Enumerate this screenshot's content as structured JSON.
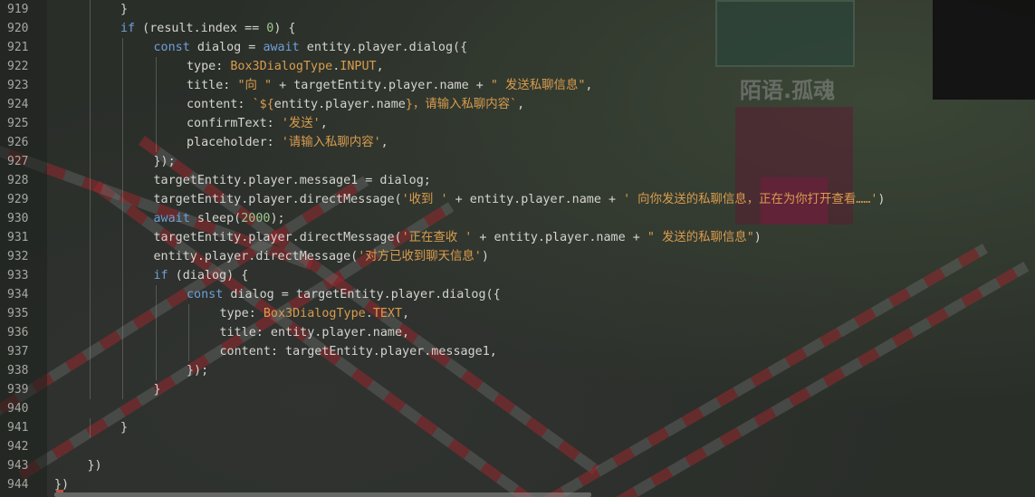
{
  "watermark": "陌语.孤魂",
  "lines": [
    {
      "no": "919",
      "indent": 2,
      "tokens": [
        {
          "t": "}",
          "c": ""
        }
      ]
    },
    {
      "no": "920",
      "indent": 2,
      "tokens": [
        {
          "t": "if",
          "c": "kw"
        },
        {
          "t": " (result.index == ",
          "c": ""
        },
        {
          "t": "0",
          "c": "num"
        },
        {
          "t": ") {",
          "c": ""
        }
      ]
    },
    {
      "no": "921",
      "indent": 3,
      "tokens": [
        {
          "t": "const",
          "c": "kw"
        },
        {
          "t": " dialog = ",
          "c": ""
        },
        {
          "t": "await",
          "c": "kw"
        },
        {
          "t": " entity.player.dialog({",
          "c": ""
        }
      ]
    },
    {
      "no": "922",
      "indent": 4,
      "tokens": [
        {
          "t": "type: ",
          "c": ""
        },
        {
          "t": "Box3DialogType",
          "c": "cls"
        },
        {
          "t": ".",
          "c": ""
        },
        {
          "t": "INPUT",
          "c": "cls"
        },
        {
          "t": ",",
          "c": ""
        }
      ]
    },
    {
      "no": "923",
      "indent": 4,
      "tokens": [
        {
          "t": "title: ",
          "c": ""
        },
        {
          "t": "\"向 \"",
          "c": "str"
        },
        {
          "t": " + targetEntity.player.name + ",
          "c": ""
        },
        {
          "t": "\" 发送私聊信息\"",
          "c": "str"
        },
        {
          "t": ",",
          "c": ""
        }
      ]
    },
    {
      "no": "924",
      "indent": 4,
      "tokens": [
        {
          "t": "content: ",
          "c": ""
        },
        {
          "t": "`${",
          "c": "str"
        },
        {
          "t": "entity.player.name",
          "c": ""
        },
        {
          "t": "}，请输入私聊内容`",
          "c": "str"
        },
        {
          "t": ",",
          "c": ""
        }
      ]
    },
    {
      "no": "925",
      "indent": 4,
      "tokens": [
        {
          "t": "confirmText: ",
          "c": ""
        },
        {
          "t": "'发送'",
          "c": "str"
        },
        {
          "t": ",",
          "c": ""
        }
      ]
    },
    {
      "no": "926",
      "indent": 4,
      "tokens": [
        {
          "t": "placeholder: ",
          "c": ""
        },
        {
          "t": "'请输入私聊内容'",
          "c": "str"
        },
        {
          "t": ",",
          "c": ""
        }
      ]
    },
    {
      "no": "927",
      "indent": 3,
      "tokens": [
        {
          "t": "});",
          "c": ""
        }
      ]
    },
    {
      "no": "928",
      "indent": 3,
      "tokens": [
        {
          "t": "targetEntity.player.message1 = dialog;",
          "c": ""
        }
      ]
    },
    {
      "no": "929",
      "indent": 3,
      "tokens": [
        {
          "t": "targetEntity.player.directMessage(",
          "c": ""
        },
        {
          "t": "'收到 '",
          "c": "str"
        },
        {
          "t": " + entity.player.name + ",
          "c": ""
        },
        {
          "t": "' 向你发送的私聊信息，正在为你打开查看……'",
          "c": "str"
        },
        {
          "t": ")",
          "c": ""
        }
      ]
    },
    {
      "no": "930",
      "indent": 3,
      "tokens": [
        {
          "t": "await",
          "c": "kw"
        },
        {
          "t": " sleep(",
          "c": ""
        },
        {
          "t": "2000",
          "c": "num"
        },
        {
          "t": ");",
          "c": ""
        }
      ]
    },
    {
      "no": "931",
      "indent": 3,
      "tokens": [
        {
          "t": "targetEntity.player.directMessage(",
          "c": ""
        },
        {
          "t": "'正在查收 '",
          "c": "str"
        },
        {
          "t": " + entity.player.name + ",
          "c": ""
        },
        {
          "t": "\" 发送的私聊信息\"",
          "c": "str"
        },
        {
          "t": ")",
          "c": ""
        }
      ]
    },
    {
      "no": "932",
      "indent": 3,
      "tokens": [
        {
          "t": "entity.player.directMessage(",
          "c": ""
        },
        {
          "t": "'对方已收到聊天信息'",
          "c": "str"
        },
        {
          "t": ")",
          "c": ""
        }
      ]
    },
    {
      "no": "933",
      "indent": 3,
      "tokens": [
        {
          "t": "if",
          "c": "kw"
        },
        {
          "t": " (dialog) {",
          "c": ""
        }
      ]
    },
    {
      "no": "934",
      "indent": 4,
      "tokens": [
        {
          "t": "const",
          "c": "kw"
        },
        {
          "t": " dialog = targetEntity.player.dialog({",
          "c": ""
        }
      ]
    },
    {
      "no": "935",
      "indent": 5,
      "tokens": [
        {
          "t": "type: ",
          "c": ""
        },
        {
          "t": "Box3DialogType",
          "c": "cls"
        },
        {
          "t": ".",
          "c": ""
        },
        {
          "t": "TEXT",
          "c": "cls"
        },
        {
          "t": ",",
          "c": ""
        }
      ]
    },
    {
      "no": "936",
      "indent": 5,
      "tokens": [
        {
          "t": "title: entity.player.name,",
          "c": ""
        }
      ]
    },
    {
      "no": "937",
      "indent": 5,
      "tokens": [
        {
          "t": "content: targetEntity.player.message1,",
          "c": ""
        }
      ]
    },
    {
      "no": "938",
      "indent": 4,
      "tokens": [
        {
          "t": "});",
          "c": ""
        }
      ]
    },
    {
      "no": "939",
      "indent": 3,
      "tokens": [
        {
          "t": "}",
          "c": ""
        }
      ]
    },
    {
      "no": "940",
      "indent": 0,
      "tokens": []
    },
    {
      "no": "941",
      "indent": 2,
      "tokens": [
        {
          "t": "}",
          "c": ""
        }
      ]
    },
    {
      "no": "942",
      "indent": 0,
      "tokens": []
    },
    {
      "no": "943",
      "indent": 1,
      "tokens": [
        {
          "t": "})",
          "c": ""
        }
      ]
    },
    {
      "no": "944",
      "indent": 0,
      "tokens": [
        {
          "t": "})",
          "c": ""
        }
      ]
    }
  ]
}
